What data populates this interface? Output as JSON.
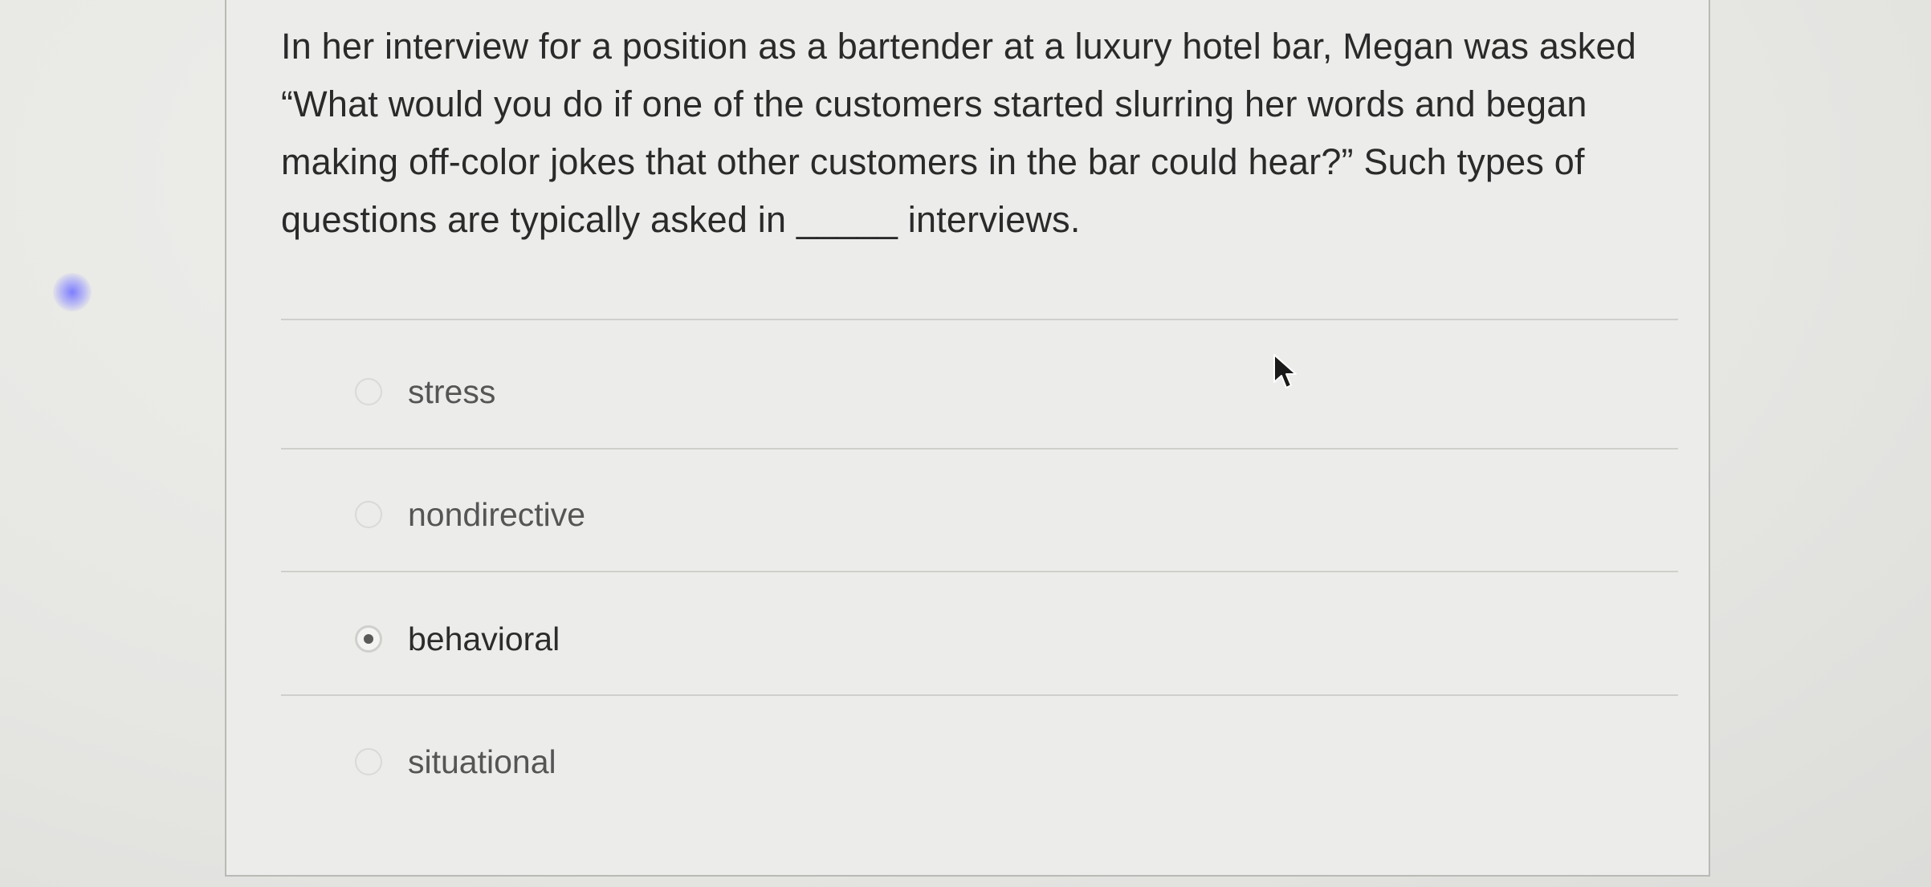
{
  "question": {
    "text": "In her interview for a position as a bartender at a luxury hotel bar, Megan was asked “What would you do if one of the customers started slurring her words and began making off-color jokes that other customers in the bar could hear?” Such types of questions are typically asked in _____ interviews."
  },
  "options": [
    {
      "label": "stress",
      "selected": false
    },
    {
      "label": "nondirective",
      "selected": false
    },
    {
      "label": "behavioral",
      "selected": true
    },
    {
      "label": "situational",
      "selected": false
    }
  ],
  "icons": {
    "cursor": "arrow-cursor-icon",
    "radio": "radio-button-icon"
  },
  "colors": {
    "background": "#e6e6e3",
    "card": "#ececea",
    "text": "#2a2a2a",
    "glow": "#8080ff"
  }
}
